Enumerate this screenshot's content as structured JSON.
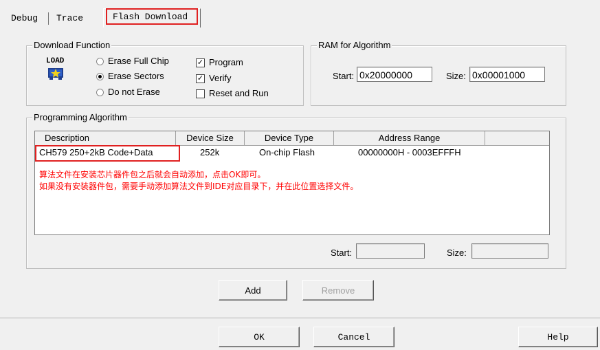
{
  "tabs": [
    {
      "label": "Debug"
    },
    {
      "label": "Trace"
    },
    {
      "label": "Flash Download"
    }
  ],
  "download_function": {
    "title": "Download Function",
    "icon_text": "LOAD",
    "radios": [
      {
        "label": "Erase Full Chip",
        "checked": false
      },
      {
        "label": "Erase Sectors",
        "checked": true
      },
      {
        "label": "Do not Erase",
        "checked": false
      }
    ],
    "checks": [
      {
        "label": "Program",
        "checked": true
      },
      {
        "label": "Verify",
        "checked": true
      },
      {
        "label": "Reset and Run",
        "checked": false
      }
    ]
  },
  "ram": {
    "title": "RAM for Algorithm",
    "start_label": "Start:",
    "start_value": "0x20000000",
    "size_label": "Size:",
    "size_value": "0x00001000"
  },
  "programming": {
    "title": "Programming Algorithm",
    "columns": [
      "Description",
      "Device Size",
      "Device Type",
      "Address Range"
    ],
    "rows": [
      {
        "description": "CH579 250+2kB Code+Data",
        "size": "252k",
        "type": "On-chip Flash",
        "range": "00000000H - 0003EFFFH"
      }
    ],
    "notes": [
      "算法文件在安装芯片器件包之后就会自动添加，点击OK即可。",
      "如果没有安装器件包，需要手动添加算法文件到IDE对应目录下，并在此位置选择文件。"
    ],
    "start_label": "Start:",
    "start_value": "",
    "size_label": "Size:",
    "size_value": ""
  },
  "buttons": {
    "add": "Add",
    "remove": "Remove",
    "ok": "OK",
    "cancel": "Cancel",
    "help": "Help"
  }
}
